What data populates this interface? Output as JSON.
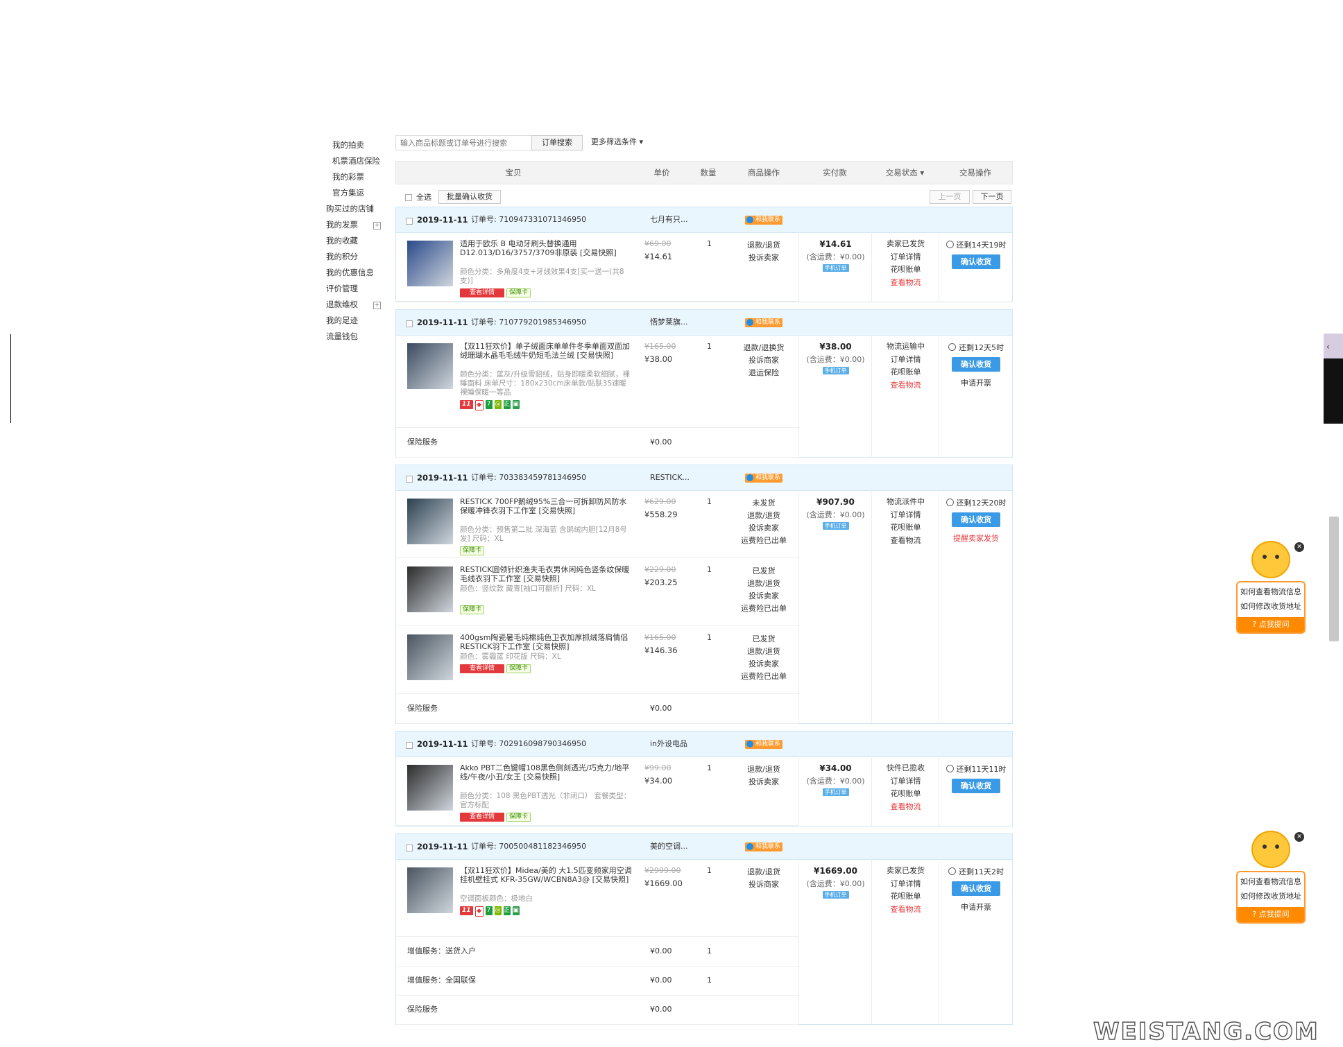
{
  "sidebar": {
    "items": [
      {
        "label": "我的拍卖",
        "sub": true
      },
      {
        "label": "机票酒店保险",
        "sub": true
      },
      {
        "label": "我的彩票",
        "sub": true
      },
      {
        "label": "官方集运",
        "sub": true
      },
      {
        "label": "购买过的店铺",
        "sub": false
      },
      {
        "label": "我的发票",
        "sub": false,
        "expand": true
      },
      {
        "label": "我的收藏",
        "sub": false
      },
      {
        "label": "我的积分",
        "sub": false
      },
      {
        "label": "我的优惠信息",
        "sub": false
      },
      {
        "label": "评价管理",
        "sub": false
      },
      {
        "label": "退款维权",
        "sub": false,
        "expand": true
      },
      {
        "label": "我的足迹",
        "sub": false
      },
      {
        "label": "流量钱包",
        "sub": false
      }
    ]
  },
  "search": {
    "placeholder": "输入商品标题或订单号进行搜索",
    "button": "订单搜索",
    "more": "更多筛选条件 ▾"
  },
  "table_head": {
    "item": "宝贝",
    "unit_price": "单价",
    "qty": "数量",
    "item_ops": "商品操作",
    "paid": "实付款",
    "status": "交易状态 ▾",
    "trade_ops": "交易操作"
  },
  "toolbar": {
    "select_all": "全选",
    "batch_confirm": "批量确认收货",
    "prev": "上一页",
    "next": "下一页"
  },
  "contact_label": "和我联系",
  "mobile_label": "手机订单",
  "confirm_label": "确认收货",
  "orders": [
    {
      "date": "2019-11-11",
      "order_no": "订单号: 710947331071346950",
      "shop": "七月有只...",
      "items": [
        {
          "title": "适用于欧乐 B 电动牙刷头替换通用D12.013/D16/3757/3709非原装 [交易快照]",
          "spec": "颜色分类：多角度4支+牙线效果4支[买一送一(共8支)]",
          "oprice": "¥69.00",
          "price": "¥14.61",
          "qty": "1",
          "ops": [
            "退款/退货",
            "投诉卖家"
          ],
          "badges": [
            "red",
            "green"
          ],
          "badge_red": "查看详情",
          "badge_green": "保障卡"
        }
      ],
      "extras": [],
      "paid": "¥14.61",
      "ship": "(含运费：¥0.00)",
      "status": [
        "卖家已发货",
        "订单详情",
        "花呗账单"
      ],
      "status_red": "查看物流",
      "timer": "还剩14天19时",
      "alt": "",
      "remind": ""
    },
    {
      "date": "2019-11-11",
      "order_no": "订单号: 710779201985346950",
      "shop": "悟梦莱旗...",
      "items": [
        {
          "title": "【双11狂欢价】单子绒面床单单件冬季单面双面加绒珊瑚水晶毛毛绒牛奶短毛法兰绒 [交易快照]",
          "spec": "颜色分类：蓝灰/升级雪貂绒，贴身即暖柔软细腻，裸睡面料  床单尺寸：180x230cm床单款/贴肤3S速暖裸睡保暖一等品",
          "oprice": "¥165.00",
          "price": "¥38.00",
          "qty": "1",
          "ops": [
            "退款/退换货",
            "投诉商家",
            "退运保险"
          ],
          "badges": [
            "d11"
          ]
        }
      ],
      "extras": [
        {
          "label": "保险服务",
          "value": "¥0.00",
          "qty": ""
        }
      ],
      "paid": "¥38.00",
      "ship": "(含运费：¥0.00)",
      "status": [
        "物流运输中",
        "订单详情",
        "花呗账单"
      ],
      "status_red": "查看物流",
      "timer": "还剩12天5时",
      "alt": "申请开票",
      "remind": ""
    },
    {
      "date": "2019-11-11",
      "order_no": "订单号: 703383459781346950",
      "shop": "RESTICK...",
      "items": [
        {
          "title": "RESTICK 700FP鹅绒95%三合一可拆卸防风防水保暖冲锋衣羽下工作室 [交易快照]",
          "spec": "颜色分类：预售第二批 深海蓝 含鹅绒内胆[12月8号发]  尺码：XL",
          "oprice": "¥629.00",
          "price": "¥558.29",
          "qty": "1",
          "ops": [
            "未发货",
            "退款/退货",
            "投诉卖家",
            "运费险已出单"
          ],
          "badges": [
            "green"
          ],
          "badge_green": "保障卡"
        },
        {
          "title": "RESTICK圆领针织渔夫毛衣男休闲纯色竖条纹保暖毛线衣羽下工作室 [交易快照]",
          "spec": "颜色：竖纹款 藏青[袖口可翻折]  尺码：XL",
          "oprice": "¥229.00",
          "price": "¥203.25",
          "qty": "1",
          "ops": [
            "已发货",
            "退款/退货",
            "投诉卖家",
            "运费险已出单"
          ],
          "badges": [
            "green"
          ],
          "badge_green": "保障卡"
        },
        {
          "title": "400gsm陶瓷暑毛纯棉纯色卫衣加厚抓绒落肩情侣RESTICK羽下工作室 [交易快照]",
          "spec": "颜色：雾霾蓝 印花版  尺码：XL",
          "oprice": "¥165.00",
          "price": "¥146.36",
          "qty": "1",
          "ops": [
            "已发货",
            "退款/退货",
            "投诉卖家",
            "运费险已出单"
          ],
          "badges": [
            "red",
            "green"
          ],
          "badge_red": "查看详情",
          "badge_green": "保障卡"
        }
      ],
      "extras": [
        {
          "label": "保险服务",
          "value": "¥0.00",
          "qty": ""
        }
      ],
      "paid": "¥907.90",
      "ship": "(含运费：¥0.00)",
      "status": [
        "物流派件中",
        "订单详情",
        "花呗账单",
        "查看物流"
      ],
      "status_red": "",
      "timer": "还剩12天20时",
      "alt": "",
      "remind": "提醒卖家发货"
    },
    {
      "date": "2019-11-11",
      "order_no": "订单号: 702916098790346950",
      "shop": "in外设电品",
      "items": [
        {
          "title": "Akko PBT二色键帽108黑色侧刻透光/巧克力/地平线/午夜/小丑/女王 [交易快照]",
          "spec": "颜色分类：108 黑色PBT透光（非闭口）  套餐类型：官方标配",
          "oprice": "¥99.00",
          "price": "¥34.00",
          "qty": "1",
          "ops": [
            "退款/退货",
            "投诉卖家"
          ],
          "badges": [
            "red",
            "green"
          ],
          "badge_red": "查看详情",
          "badge_green": "保障卡"
        }
      ],
      "extras": [],
      "paid": "¥34.00",
      "ship": "(含运费：¥0.00)",
      "status": [
        "快件已揽收",
        "订单详情",
        "花呗账单"
      ],
      "status_red": "查看物流",
      "timer": "还剩11天11时",
      "alt": "",
      "remind": ""
    },
    {
      "date": "2019-11-11",
      "order_no": "订单号: 700500481182346950",
      "shop": "美的空调...",
      "items": [
        {
          "title": "【双11狂欢价】Midea/美的 大1.5匹变频家用空调挂机壁挂式 KFR-35GW/WCBN8A3@ [交易快照]",
          "spec": "空调面板颜色：极地白",
          "oprice": "¥2999.00",
          "price": "¥1669.00",
          "qty": "1",
          "ops": [
            "退款/退货",
            "投诉商家"
          ],
          "badges": [
            "d11"
          ]
        }
      ],
      "extras": [
        {
          "label": "增值服务：送货入户",
          "value": "¥0.00",
          "qty": "1"
        },
        {
          "label": "增值服务：全国联保",
          "value": "¥0.00",
          "qty": "1"
        },
        {
          "label": "保险服务",
          "value": "¥0.00",
          "qty": ""
        }
      ],
      "paid": "¥1669.00",
      "ship": "(含运费：¥0.00)",
      "status": [
        "卖家已发货",
        "订单详情",
        "花呗账单"
      ],
      "status_red": "查看物流",
      "timer": "还剩11天2时",
      "alt": "申请开票",
      "remind": ""
    }
  ],
  "robot": {
    "q1": "如何查看物流信息",
    "q2": "如何修改收货地址",
    "ask": "点我提问"
  },
  "watermark": "WEISTANG.COM",
  "colors": {
    "accent": "#3a9ae6",
    "red": "#e4393c",
    "order_header_bg": "#eaf6fd",
    "orange": "#ff8a00"
  }
}
